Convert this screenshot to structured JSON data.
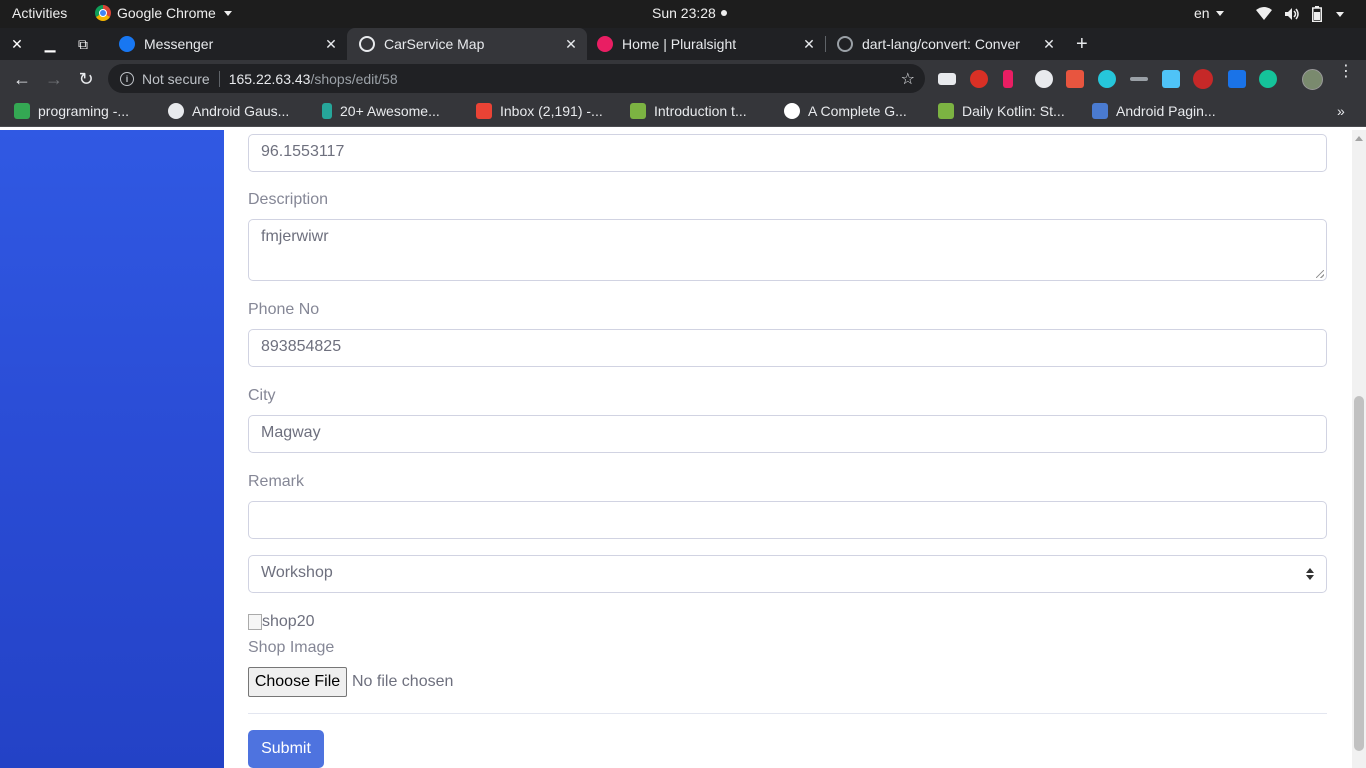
{
  "system": {
    "activities": "Activities",
    "app_name": "Google Chrome",
    "clock": "Sun 23:28",
    "language": "en"
  },
  "tabs": [
    {
      "title": "Messenger",
      "favicon_color": "#1877f2",
      "active": false
    },
    {
      "title": "CarService Map",
      "favicon_color": "#e8eaed",
      "active": true
    },
    {
      "title": "Home | Pluralsight",
      "favicon_color": "#e91e63",
      "active": false
    },
    {
      "title": "dart-lang/convert: Conver",
      "favicon_color": "#202124",
      "active": false
    }
  ],
  "omnibox": {
    "security": "Not secure",
    "host": "165.22.63.43",
    "path": "/shops/edit/58"
  },
  "bookmarks": [
    {
      "label": "programing -...",
      "color": "#34a853"
    },
    {
      "label": "Android Gaus...",
      "color": "#e8eaed"
    },
    {
      "label": "20+ Awesome...",
      "color": "#26a69a"
    },
    {
      "label": "Inbox (2,191) -...",
      "color": "#ea4335"
    },
    {
      "label": "Introduction t...",
      "color": "#7cb342"
    },
    {
      "label": "A Complete G...",
      "color": "#ffffff"
    },
    {
      "label": "Daily Kotlin: St...",
      "color": "#7cb342"
    },
    {
      "label": "Android Pagin...",
      "color": "#4a7bd0"
    }
  ],
  "form": {
    "longitude_value": "96.1553117",
    "description_label": "Description",
    "description_value": "fmjerwiwr",
    "phone_label": "Phone No",
    "phone_value": "893854825",
    "city_label": "City",
    "city_value": "Magway",
    "remark_label": "Remark",
    "remark_value": "",
    "type_selected": "Workshop",
    "image_alt": "shop20",
    "image_label": "Shop Image",
    "file_button": "Choose File",
    "file_status": "No file chosen",
    "submit_label": "Submit"
  },
  "colors": {
    "sidebar_top": "#3059e3",
    "sidebar_bottom": "#2342c6",
    "primary": "#4e73df"
  }
}
